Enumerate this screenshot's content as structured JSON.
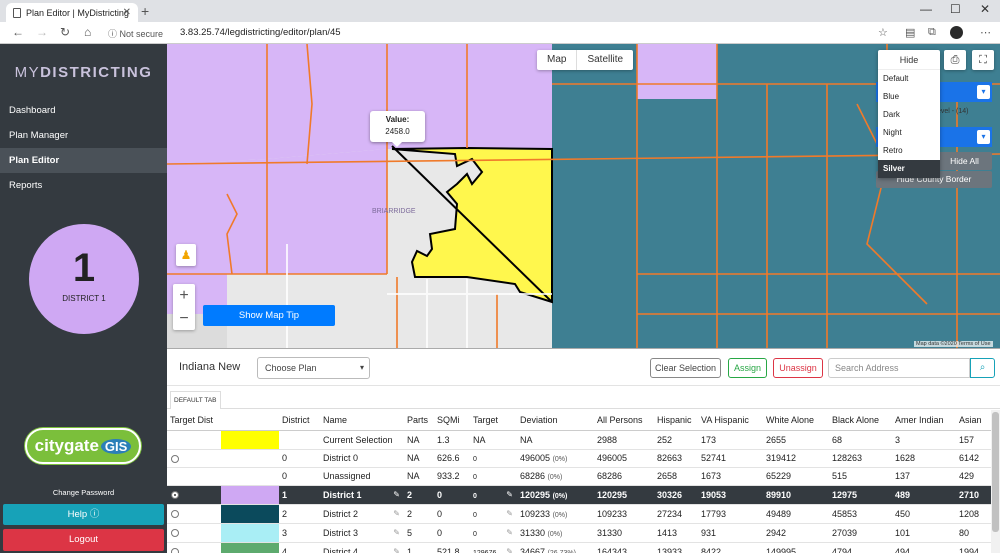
{
  "browser": {
    "tab_title": "Plan Editor | MyDistricting",
    "security": "Not secure",
    "url": "3.83.25.74/legdistricting/editor/plan/45"
  },
  "sidebar": {
    "logo_light": "MY",
    "logo_bold": "DISTRICTING",
    "items": [
      {
        "label": "Dashboard"
      },
      {
        "label": "Plan Manager"
      },
      {
        "label": "Plan Editor"
      },
      {
        "label": "Reports"
      }
    ],
    "district_number": "1",
    "district_label": "DISTRICT 1",
    "district_color": "#cfa8f3",
    "cg_logo_text": "citygate",
    "cg_logo_gis": "GIS",
    "change_password": "Change Password",
    "help_label": "Help ⓘ",
    "logout_label": "Logout"
  },
  "map": {
    "type_map": "Map",
    "type_satellite": "Satellite",
    "tooltip_label": "Value:",
    "tooltip_value": "2458.0",
    "show_map_tip": "Show Map Tip",
    "style_dropdown_title": "Hide",
    "style_options": [
      "Default",
      "Blue",
      "Dark",
      "Night",
      "Retro",
      "Silver"
    ],
    "style_selected": "Silver",
    "layer_level_text": "evel - (14)",
    "hide_all": "Hide All",
    "hide_county_border": "Hide County Border",
    "attribution": "Map data ©2020   Terms of Use",
    "place_label": "BRIARRIDGE"
  },
  "toolbar": {
    "plan_name": "Indiana New",
    "choose_plan": "Choose Plan",
    "clear_selection": "Clear Selection",
    "assign": "Assign",
    "unassign": "Unassign",
    "search_placeholder": "Search Address",
    "default_tab": "DEFAULT TAB"
  },
  "table": {
    "columns": [
      "Target Dist",
      "",
      "District",
      "Name",
      "Parts",
      "SQMi",
      "Target",
      "Deviation",
      "All Persons",
      "Hispanic",
      "VA Hispanic",
      "White Alone",
      "Black Alone",
      "Amer Indian",
      "Asian"
    ],
    "rows": [
      {
        "radio": false,
        "color": "#ffff00",
        "district": "",
        "name": "Current Selection",
        "parts": "NA",
        "sqmi": "1.3",
        "target": "NA",
        "deviation": "NA",
        "dev_pct": "",
        "all": "2988",
        "hisp": "252",
        "vahisp": "173",
        "white": "2655",
        "black": "68",
        "amer": "3",
        "asian": "157"
      },
      {
        "radio": true,
        "color": "",
        "district": "0",
        "name": "District 0",
        "parts": "NA",
        "sqmi": "626.6",
        "target": "0",
        "deviation": "496005",
        "dev_pct": "(0%)",
        "all": "496005",
        "hisp": "82663",
        "vahisp": "52741",
        "white": "319412",
        "black": "128263",
        "amer": "1628",
        "asian": "6142"
      },
      {
        "radio": false,
        "color": "",
        "district": "0",
        "name": "Unassigned",
        "parts": "NA",
        "sqmi": "933.2",
        "target": "0",
        "deviation": "68286",
        "dev_pct": "(0%)",
        "all": "68286",
        "hisp": "2658",
        "vahisp": "1673",
        "white": "65229",
        "black": "515",
        "amer": "137",
        "asian": "429"
      },
      {
        "radio": true,
        "selected": true,
        "color": "#cfa8f3",
        "district": "1",
        "name": "District 1",
        "parts": "2",
        "sqmi": "0",
        "target": "0",
        "deviation": "120295",
        "dev_pct": "(0%)",
        "all": "120295",
        "hisp": "30326",
        "vahisp": "19053",
        "white": "89910",
        "black": "12975",
        "amer": "489",
        "asian": "2710"
      },
      {
        "radio": true,
        "color": "#0b4a5c",
        "district": "2",
        "name": "District 2",
        "parts": "2",
        "sqmi": "0",
        "target": "0",
        "deviation": "109233",
        "dev_pct": "(0%)",
        "all": "109233",
        "hisp": "27234",
        "vahisp": "17793",
        "white": "49489",
        "black": "45853",
        "amer": "450",
        "asian": "1208"
      },
      {
        "radio": true,
        "color": "#a9eef5",
        "district": "3",
        "name": "District 3",
        "parts": "5",
        "sqmi": "0",
        "target": "0",
        "deviation": "31330",
        "dev_pct": "(0%)",
        "all": "31330",
        "hisp": "1413",
        "vahisp": "931",
        "white": "2942",
        "black": "27039",
        "amer": "101",
        "asian": "80"
      },
      {
        "radio": true,
        "color": "#5daa6e",
        "district": "4",
        "name": "District 4",
        "parts": "1",
        "sqmi": "521.8",
        "target": "129676",
        "deviation": "34667",
        "dev_pct": "(26.73%)",
        "all": "164343",
        "hisp": "13933",
        "vahisp": "8422",
        "white": "149995",
        "black": "4794",
        "amer": "494",
        "asian": "1994"
      }
    ]
  }
}
